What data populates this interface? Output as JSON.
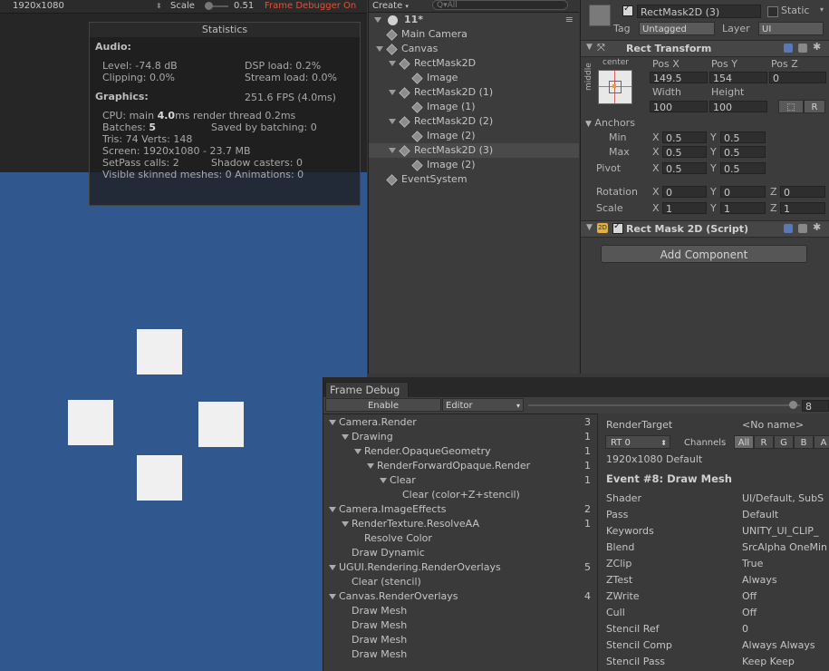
{
  "game_view": {
    "resolution": "1920x1080",
    "scale_label": "Scale",
    "scale_value": "0.51",
    "frame_debugger_status": "Frame Debugger On"
  },
  "stats": {
    "title": "Statistics",
    "audio_header": "Audio:",
    "level": "Level: -74.8 dB",
    "dsp_load": "DSP load: 0.2%",
    "clipping": "Clipping: 0.0%",
    "stream_load": "Stream load: 0.0%",
    "graphics_header": "Graphics:",
    "fps": "251.6 FPS (4.0ms)",
    "cpu_prefix": "CPU: main",
    "cpu_main": "4.0",
    "cpu_suffix": "ms  render thread 0.2ms",
    "batches_prefix": "Batches:",
    "batches": "5",
    "saved_by_batching": "Saved by batching: 0",
    "tris_verts": "Tris: 74   Verts: 148",
    "screen": "Screen: 1920x1080 - 23.7 MB",
    "setpass": "SetPass calls: 2",
    "shadow_casters": "Shadow casters: 0",
    "skinned": "Visible skinned meshes: 0  Animations: 0"
  },
  "hierarchy": {
    "create_label": "Create",
    "search_placeholder": "Q▾All",
    "scene_name": "11*",
    "items": [
      {
        "label": "Main Camera",
        "depth": 1
      },
      {
        "label": "Canvas",
        "depth": 1
      },
      {
        "label": "RectMask2D",
        "depth": 2
      },
      {
        "label": "Image",
        "depth": 3
      },
      {
        "label": "RectMask2D (1)",
        "depth": 2
      },
      {
        "label": "Image (1)",
        "depth": 3
      },
      {
        "label": "RectMask2D (2)",
        "depth": 2
      },
      {
        "label": "Image (2)",
        "depth": 3
      },
      {
        "label": "RectMask2D (3)",
        "depth": 2,
        "selected": true
      },
      {
        "label": "Image (2)",
        "depth": 3
      },
      {
        "label": "EventSystem",
        "depth": 1
      }
    ]
  },
  "inspector": {
    "object_name": "RectMask2D (3)",
    "static_label": "Static",
    "tag_label": "Tag",
    "tag_value": "Untagged",
    "layer_label": "Layer",
    "layer_value": "UI",
    "rect_transform_title": "Rect Transform",
    "anchor_preset_h": "center",
    "anchor_preset_v": "middle",
    "pos_x_label": "Pos X",
    "pos_y_label": "Pos Y",
    "pos_z_label": "Pos Z",
    "pos_x": "149.5",
    "pos_y": "154",
    "pos_z": "0",
    "width_label": "Width",
    "height_label": "Height",
    "width": "100",
    "height": "100",
    "blueprint_label": "R",
    "anchors_label": "Anchors",
    "min_label": "Min",
    "max_label": "Max",
    "pivot_label": "Pivot",
    "x_label": "X",
    "y_label": "Y",
    "z_label": "Z",
    "min_x": "0.5",
    "min_y": "0.5",
    "max_x": "0.5",
    "max_y": "0.5",
    "pivot_x": "0.5",
    "pivot_y": "0.5",
    "rotation_label": "Rotation",
    "rot_x": "0",
    "rot_y": "0",
    "rot_z": "0",
    "scale_label": "Scale",
    "scale_x": "1",
    "scale_y": "1",
    "scale_z": "1",
    "rect_mask_title": "Rect Mask 2D (Script)",
    "add_component": "Add Component"
  },
  "frame_debug": {
    "tab_label": "Frame Debug",
    "enable_button": "Enable",
    "editor_dropdown": "Editor",
    "event_number": "8",
    "tree": [
      {
        "label": "Camera.Render",
        "depth": 0,
        "expand": true,
        "count": "3"
      },
      {
        "label": "Drawing",
        "depth": 1,
        "expand": true,
        "count": "1"
      },
      {
        "label": "Render.OpaqueGeometry",
        "depth": 2,
        "expand": true,
        "count": "1"
      },
      {
        "label": "RenderForwardOpaque.Render",
        "depth": 3,
        "expand": true,
        "count": "1"
      },
      {
        "label": "Clear",
        "depth": 4,
        "expand": true,
        "count": "1"
      },
      {
        "label": "Clear (color+Z+stencil)",
        "depth": 5,
        "expand": false,
        "count": ""
      },
      {
        "label": "Camera.ImageEffects",
        "depth": 0,
        "expand": true,
        "count": "2"
      },
      {
        "label": "RenderTexture.ResolveAA",
        "depth": 1,
        "expand": true,
        "count": "1"
      },
      {
        "label": "Resolve Color",
        "depth": 2,
        "expand": false,
        "count": ""
      },
      {
        "label": "Draw Dynamic",
        "depth": 1,
        "expand": false,
        "count": ""
      },
      {
        "label": "UGUI.Rendering.RenderOverlays",
        "depth": 0,
        "expand": true,
        "count": "5"
      },
      {
        "label": "Clear (stencil)",
        "depth": 1,
        "expand": false,
        "count": ""
      },
      {
        "label": "Canvas.RenderOverlays",
        "depth": 0,
        "expand": true,
        "count": "4"
      },
      {
        "label": "Draw Mesh",
        "depth": 1,
        "expand": false,
        "count": ""
      },
      {
        "label": "Draw Mesh",
        "depth": 1,
        "expand": false,
        "count": ""
      },
      {
        "label": "Draw Mesh",
        "depth": 1,
        "expand": false,
        "count": ""
      },
      {
        "label": "Draw Mesh",
        "depth": 1,
        "expand": false,
        "count": ""
      }
    ],
    "render_target_label": "RenderTarget",
    "render_target_value": "<No name>",
    "rt_dropdown": "RT 0",
    "channels_label": "Channels",
    "channels": [
      "All",
      "R",
      "G",
      "B",
      "A"
    ],
    "rt_info": "1920x1080 Default",
    "event_title": "Event #8: Draw Mesh",
    "props": [
      {
        "k": "Shader",
        "v": "UI/Default, SubS"
      },
      {
        "k": "Pass",
        "v": "Default"
      },
      {
        "k": "Keywords",
        "v": "UNITY_UI_CLIP_"
      },
      {
        "k": "Blend",
        "v": "SrcAlpha OneMin"
      },
      {
        "k": "ZClip",
        "v": "True"
      },
      {
        "k": "ZTest",
        "v": "Always"
      },
      {
        "k": "ZWrite",
        "v": "Off"
      },
      {
        "k": "Cull",
        "v": "Off"
      },
      {
        "k": "Stencil Ref",
        "v": "0"
      },
      {
        "k": "Stencil Comp",
        "v": "Always Always"
      },
      {
        "k": "Stencil Pass",
        "v": "Keep Keep"
      }
    ]
  }
}
